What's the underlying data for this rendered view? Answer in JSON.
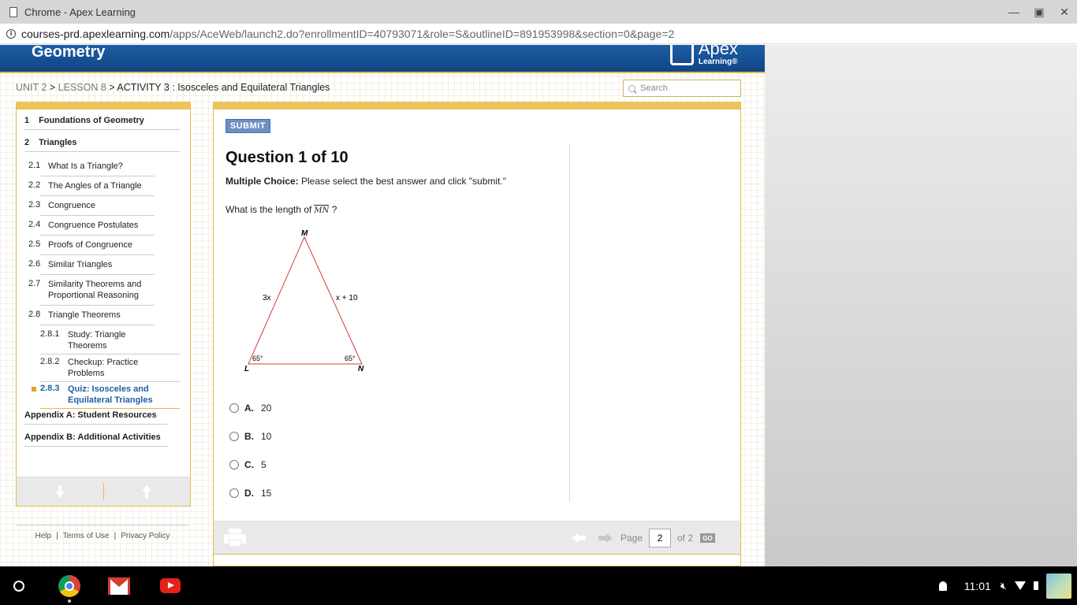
{
  "window": {
    "title": "Chrome - Apex Learning",
    "url_host": "courses-prd.apexlearning.com",
    "url_rest": "/apps/AceWeb/launch2.do?enrollmentID=40793071&role=S&outlineID=891953998&section=0&page=2"
  },
  "header": {
    "course": "Geometry",
    "logo_brand": "Apex",
    "logo_sub": "Learning®"
  },
  "breadcrumb": {
    "unit": "UNIT 2",
    "lesson": "LESSON 8",
    "activity": "ACTIVITY 3 : Isosceles and Equilateral Triangles",
    "sep": ">"
  },
  "search": {
    "placeholder": "Search"
  },
  "sidebar": {
    "units": [
      {
        "num": "1",
        "label": "Foundations of Geometry"
      },
      {
        "num": "2",
        "label": "Triangles"
      }
    ],
    "lessons": [
      {
        "num": "2.1",
        "label": "What Is a Triangle?"
      },
      {
        "num": "2.2",
        "label": "The Angles of a Triangle"
      },
      {
        "num": "2.3",
        "label": "Congruence"
      },
      {
        "num": "2.4",
        "label": "Congruence Postulates"
      },
      {
        "num": "2.5",
        "label": "Proofs of Congruence"
      },
      {
        "num": "2.6",
        "label": "Similar Triangles"
      },
      {
        "num": "2.7",
        "label": "Similarity Theorems and Proportional Reasoning"
      },
      {
        "num": "2.8",
        "label": "Triangle Theorems"
      }
    ],
    "activities": [
      {
        "num": "2.8.1",
        "label": "Study: Triangle Theorems"
      },
      {
        "num": "2.8.2",
        "label": "Checkup: Practice Problems"
      },
      {
        "num": "2.8.3",
        "label": "Quiz: Isosceles and Equilateral Triangles"
      }
    ],
    "appendices": [
      {
        "label": "Appendix A: Student Resources"
      },
      {
        "label": "Appendix B: Additional Activities"
      }
    ]
  },
  "footer": {
    "help": "Help",
    "terms": "Terms of Use",
    "privacy": "Privacy Policy",
    "sep": "|"
  },
  "question": {
    "submit_label": "SUBMIT",
    "title": "Question 1 of 10",
    "instr_bold": "Multiple Choice:",
    "instr_rest": "Please select the best answer and click \"submit.\"",
    "prompt": "What is the length of",
    "segment": "MN",
    "prompt_end": "?",
    "figure": {
      "vertex_top": "M",
      "vertex_left": "L",
      "vertex_right": "N",
      "side_left": "3x",
      "side_right": "x + 10",
      "angle_left": "65°",
      "angle_right": "65°",
      "stroke_color": "#d23b3b"
    },
    "choices": [
      {
        "letter": "A.",
        "value": "20"
      },
      {
        "letter": "B.",
        "value": "10"
      },
      {
        "letter": "C.",
        "value": "5"
      },
      {
        "letter": "D.",
        "value": "15"
      }
    ]
  },
  "pager": {
    "page_label": "Page",
    "current_page": "2",
    "of_label": "of 2",
    "go_label": "GO"
  },
  "shelf": {
    "time": "11:01"
  },
  "colors": {
    "accent_gold": "#e5b94a",
    "banner_blue": "#1f5ea4",
    "active_link": "#1f5ea4"
  }
}
